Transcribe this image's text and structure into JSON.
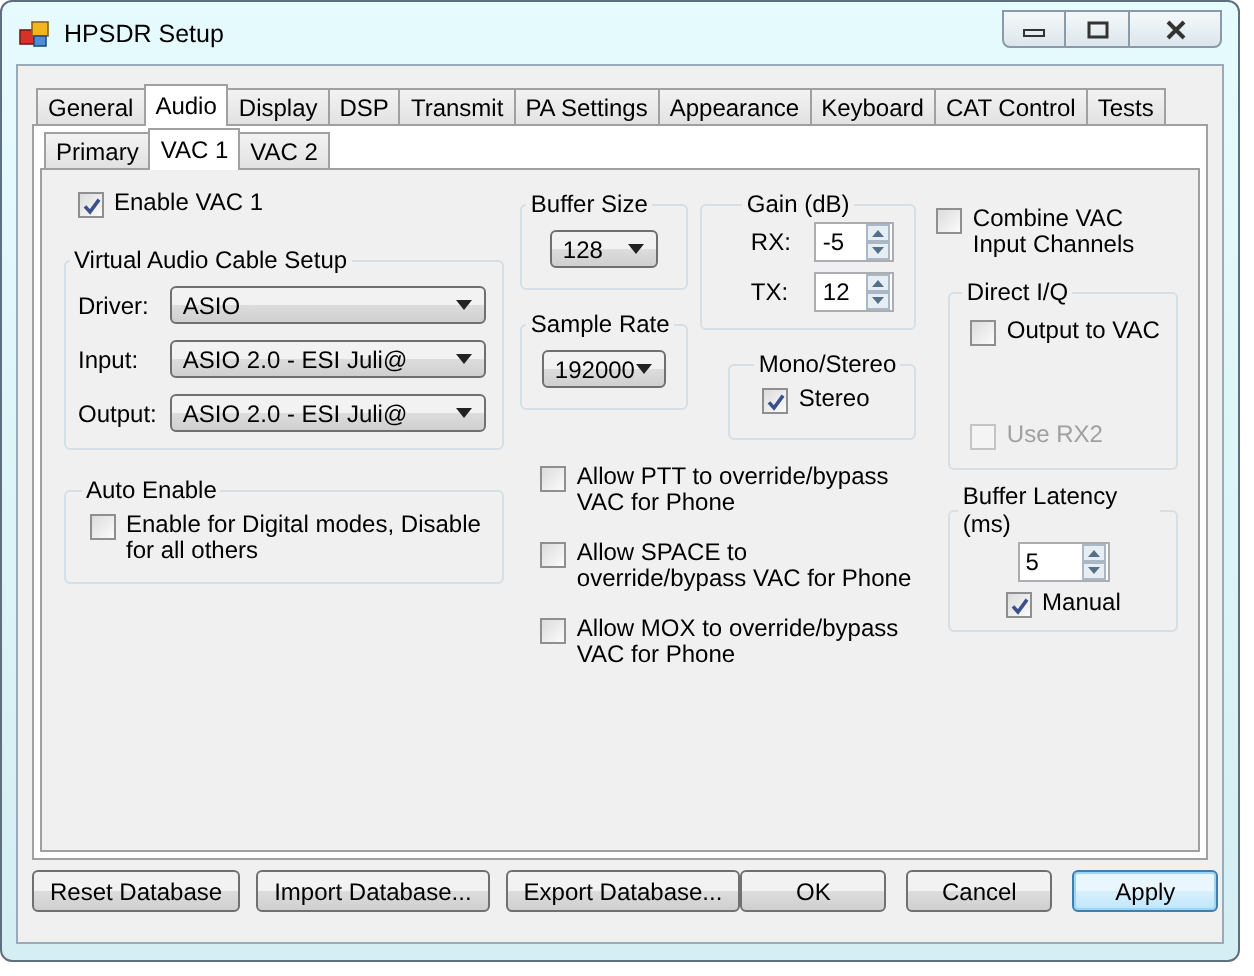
{
  "window": {
    "title": "HPSDR Setup"
  },
  "tabs": [
    {
      "label": "General",
      "selected": false
    },
    {
      "label": "Audio",
      "selected": true
    },
    {
      "label": "Display",
      "selected": false
    },
    {
      "label": "DSP",
      "selected": false
    },
    {
      "label": "Transmit",
      "selected": false
    },
    {
      "label": "PA Settings",
      "selected": false
    },
    {
      "label": "Appearance",
      "selected": false
    },
    {
      "label": "Keyboard",
      "selected": false
    },
    {
      "label": "CAT Control",
      "selected": false
    },
    {
      "label": "Tests",
      "selected": false
    }
  ],
  "subtabs": [
    {
      "label": "Primary",
      "selected": false
    },
    {
      "label": "VAC 1",
      "selected": true
    },
    {
      "label": "VAC 2",
      "selected": false
    }
  ],
  "enable_vac": {
    "label": "Enable VAC 1",
    "checked": true
  },
  "vac_setup": {
    "title": "Virtual Audio Cable Setup",
    "fields": [
      {
        "label": "Driver:",
        "value": "ASIO"
      },
      {
        "label": "Input:",
        "value": "ASIO 2.0 - ESI Juli@"
      },
      {
        "label": "Output:",
        "value": "ASIO 2.0 - ESI Juli@"
      }
    ]
  },
  "auto_enable": {
    "title": "Auto Enable",
    "option": {
      "label": "Enable for Digital modes, Disable for all others",
      "checked": false
    }
  },
  "buffer_size": {
    "title": "Buffer Size",
    "value": "128"
  },
  "sample_rate": {
    "title": "Sample Rate",
    "value": "192000"
  },
  "gain": {
    "title": "Gain (dB)",
    "fields": [
      {
        "label": "RX:",
        "value": "-5"
      },
      {
        "label": "TX:",
        "value": "12"
      }
    ]
  },
  "mono_stereo": {
    "title": "Mono/Stereo",
    "option": {
      "label": "Stereo",
      "checked": true
    }
  },
  "overrides": [
    {
      "label": "Allow PTT to override/bypass VAC for Phone",
      "checked": false
    },
    {
      "label": "Allow SPACE to override/bypass VAC for Phone",
      "checked": false
    },
    {
      "label": "Allow MOX to override/bypass VAC for Phone",
      "checked": false
    }
  ],
  "combine": {
    "label": "Combine VAC Input Channels",
    "checked": false
  },
  "direct_iq": {
    "title": "Direct I/Q",
    "options": [
      {
        "label": "Output to VAC",
        "checked": false,
        "disabled": false
      },
      {
        "label": "Use RX2",
        "checked": false,
        "disabled": true
      }
    ]
  },
  "buffer_latency": {
    "title": "Buffer Latency (ms)",
    "value": "5",
    "manual": {
      "label": "Manual",
      "checked": true
    }
  },
  "left_buttons": [
    {
      "label": "Reset Database",
      "focused": false
    },
    {
      "label": "Import Database...",
      "focused": false
    },
    {
      "label": "Export Database...",
      "focused": false
    }
  ],
  "right_buttons": [
    {
      "label": "OK",
      "focused": false
    },
    {
      "label": "Cancel",
      "focused": false
    },
    {
      "label": "Apply",
      "focused": true
    }
  ]
}
